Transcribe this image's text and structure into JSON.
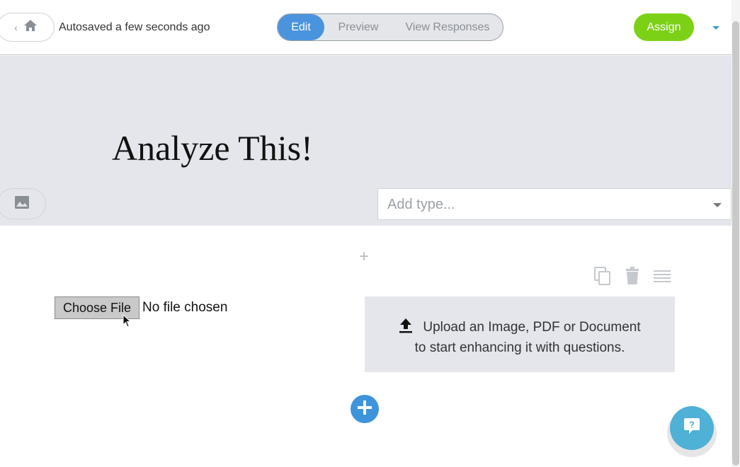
{
  "topbar": {
    "autosave_text": "Autosaved a few seconds ago",
    "tabs": [
      {
        "label": "Edit",
        "active": true
      },
      {
        "label": "Preview",
        "active": false
      },
      {
        "label": "View Responses",
        "active": false
      }
    ],
    "assign_label": "Assign"
  },
  "header": {
    "title": "Analyze This!",
    "type_placeholder": "Add type..."
  },
  "body": {
    "choose_file_label": "Choose File",
    "file_status": "No file chosen",
    "upload_line1": "Upload an Image, PDF or Document",
    "upload_line2": "to start enhancing it with questions."
  },
  "icons": {
    "home": "home-icon",
    "back": "chevron-left-icon",
    "image": "image-icon",
    "duplicate": "copy-icon",
    "delete": "trash-icon",
    "reorder": "drag-handle-icon",
    "upload": "upload-icon",
    "add": "plus-icon",
    "help": "help-chat-icon"
  },
  "colors": {
    "accent_blue": "#4a94dd",
    "assign_green": "#7cd117",
    "help_teal": "#4fb1d6",
    "header_bg": "#e4e6ec"
  }
}
